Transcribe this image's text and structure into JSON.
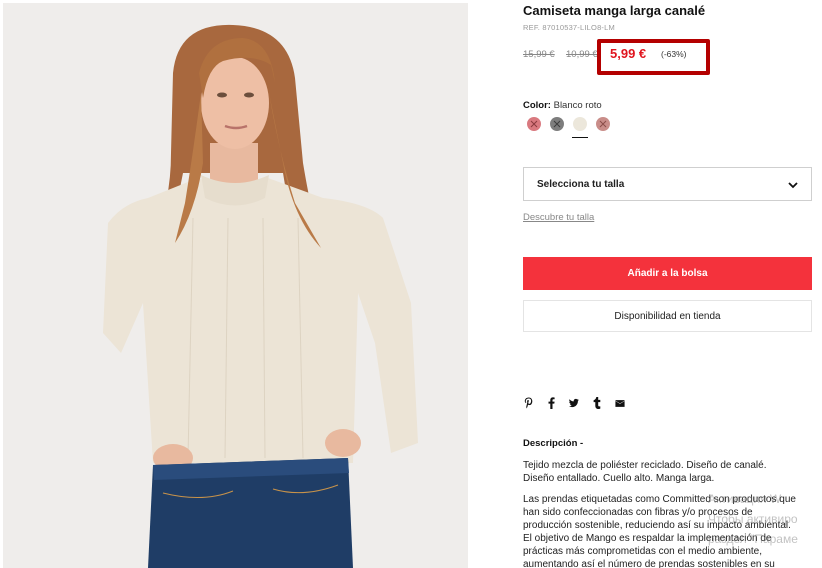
{
  "product": {
    "title": "Camiseta manga larga canalé",
    "ref": "REF. 87010537-LILO8-LM"
  },
  "pricing": {
    "original_price": "15,99 €",
    "previous_price": "10,99 €",
    "sale_price": "5,99 €",
    "discount": "(-63%)",
    "highlight_color": "#b40000",
    "sale_color": "#e0141e"
  },
  "color": {
    "label": "Color:",
    "selected": "Blanco roto",
    "swatches": [
      {
        "name": "rosa",
        "hex": "#d9797f",
        "available": false
      },
      {
        "name": "gris",
        "hex": "#7d7d7d",
        "available": false
      },
      {
        "name": "blanco roto",
        "hex": "#ece7db",
        "available": true,
        "selected": true
      },
      {
        "name": "marrón rosado",
        "hex": "#c98d89",
        "available": false
      }
    ]
  },
  "size": {
    "placeholder": "Selecciona tu talla",
    "guide_link": "Descubre tu talla"
  },
  "actions": {
    "add_to_bag": "Añadir a la bolsa",
    "store_availability": "Disponibilidad en tienda",
    "primary_color": "#f4323c"
  },
  "share_icons": [
    "pinterest-icon",
    "facebook-icon",
    "twitter-icon",
    "tumblr-icon",
    "email-icon"
  ],
  "description": {
    "heading": "Descripción -",
    "paragraph1": "Tejido mezcla de poliéster reciclado. Diseño de canalé. Diseño entallado. Cuello alto. Manga larga.",
    "paragraph2": "Las prendas etiquetadas como Committed son productos que han sido confeccionadas con fibras y/o procesos de producción sostenible, reduciendo así su impacto ambiental. El objetivo de Mango es respaldar la implementación de prácticas más comprometidas con el medio ambiente, aumentando así el número de prendas sostenibles en su"
  },
  "watermark": {
    "line1": "Активация W",
    "line2": "Чтобы активиро",
    "line3": "раздел \"Параме"
  }
}
